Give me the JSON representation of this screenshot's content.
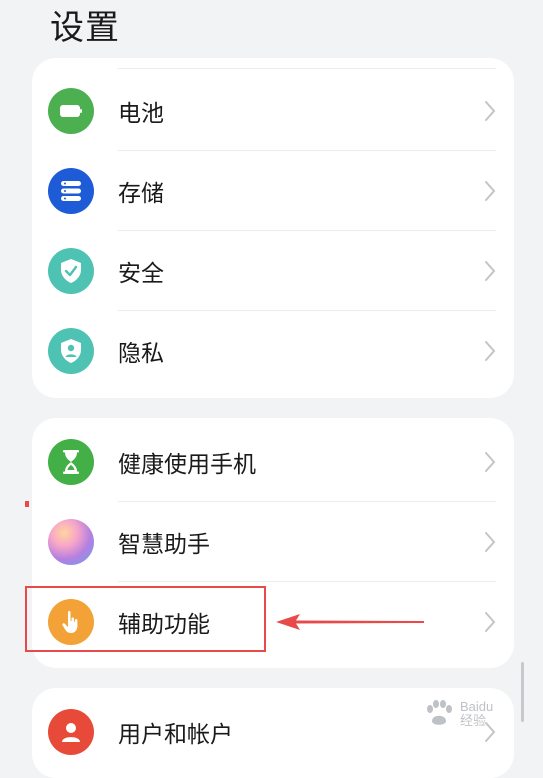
{
  "header": {
    "title": "设置"
  },
  "groups": [
    {
      "items": [
        {
          "label": "电池",
          "icon": "battery-icon",
          "icon_color": "#4caf50"
        },
        {
          "label": "存储",
          "icon": "storage-icon",
          "icon_color": "#1e5bd6"
        },
        {
          "label": "安全",
          "icon": "shield-check-icon",
          "icon_color": "#4fc3b3"
        },
        {
          "label": "隐私",
          "icon": "privacy-icon",
          "icon_color": "#4fc3b3"
        }
      ]
    },
    {
      "items": [
        {
          "label": "健康使用手机",
          "icon": "hourglass-icon",
          "icon_color": "#43b047"
        },
        {
          "label": "智慧助手",
          "icon": "assistant-orb-icon",
          "icon_color": "#b67fe0"
        },
        {
          "label": "辅助功能",
          "icon": "hand-pointer-icon",
          "icon_color": "#f2a236"
        }
      ]
    },
    {
      "items": [
        {
          "label": "用户和帐户",
          "icon": "user-icon",
          "icon_color": "#e84a3a"
        }
      ]
    }
  ],
  "annotation": {
    "highlight_color": "#e84a4a",
    "target": "辅助功能"
  },
  "watermark": {
    "brand": "Baidu",
    "text": "经验"
  }
}
